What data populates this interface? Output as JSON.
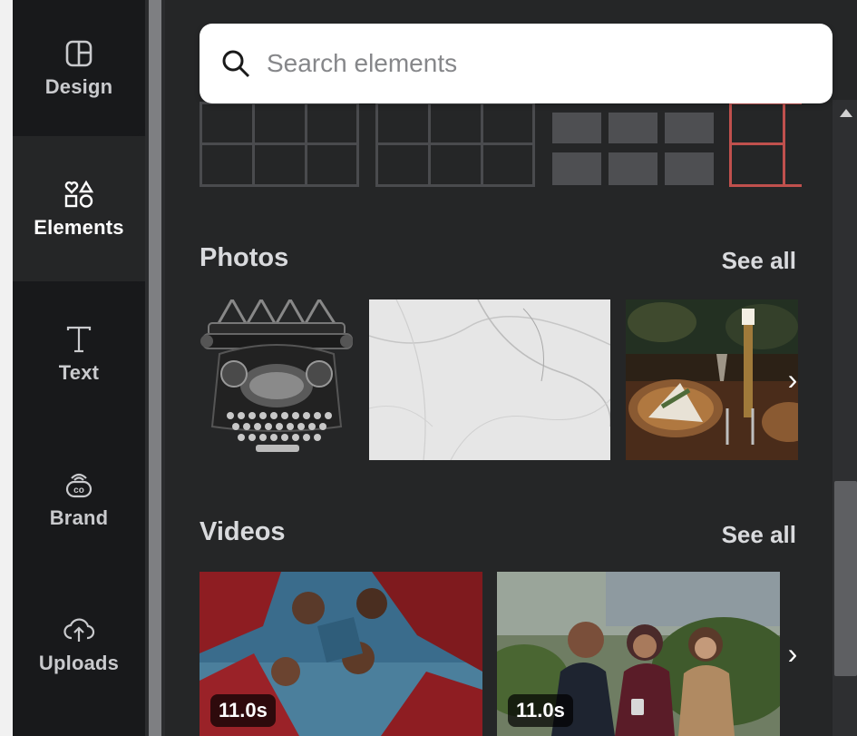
{
  "nav": {
    "items": [
      {
        "label": "Design",
        "icon": "layout-icon"
      },
      {
        "label": "Elements",
        "icon": "shapes-icon"
      },
      {
        "label": "Text",
        "icon": "text-t-icon"
      },
      {
        "label": "Brand",
        "icon": "brand-crown-icon"
      },
      {
        "label": "Uploads",
        "icon": "cloud-upload-icon"
      }
    ],
    "active": "Elements"
  },
  "search": {
    "placeholder": "Search elements",
    "value": ""
  },
  "sections": {
    "photos": {
      "title": "Photos",
      "see_all": "See all"
    },
    "videos": {
      "title": "Videos",
      "see_all": "See all"
    }
  },
  "videos": [
    {
      "duration": "11.0s"
    },
    {
      "duration": "11.0s"
    }
  ],
  "colors": {
    "rail": "#18191b",
    "panel": "#252627",
    "text": "#d9dadd",
    "grid_accent": "#c0504d"
  }
}
